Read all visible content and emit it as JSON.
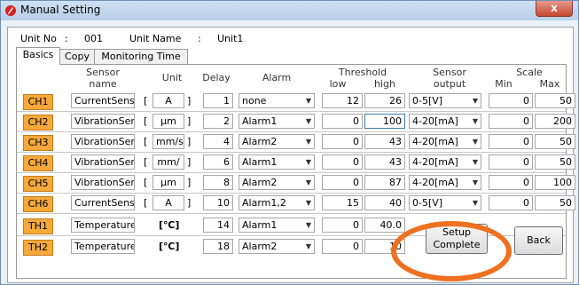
{
  "window": {
    "title": "Manual Setting",
    "close_label": "x"
  },
  "unit": {
    "no_label": "Unit No",
    "colon": ":",
    "no_value": "001",
    "name_label": "Unit Name",
    "name_value": "Unit1"
  },
  "tabs": [
    {
      "label": "Basics"
    },
    {
      "label": "Copy"
    },
    {
      "label": "Monitoring Time"
    }
  ],
  "headers": {
    "sensor_name_1": "Sensor",
    "sensor_name_2": "name",
    "unit": "Unit",
    "delay": "Delay",
    "alarm": "Alarm",
    "threshold": "Threshold",
    "low": "low",
    "high": "high",
    "sensor_output_1": "Sensor",
    "sensor_output_2": "output",
    "scale": "Scale",
    "min": "Min",
    "max": "Max"
  },
  "rows": [
    {
      "ch": "CH1",
      "name": "CurrentSens",
      "unit": "A",
      "delay": "1",
      "alarm": "none",
      "low": "12",
      "high": "26",
      "output": "0-5[V]",
      "min": "0",
      "max": "50"
    },
    {
      "ch": "CH2",
      "name": "VibrationSer",
      "unit": "μm",
      "delay": "2",
      "alarm": "Alarm1",
      "low": "0",
      "high": "100",
      "output": "4-20[mA]",
      "min": "0",
      "max": "200"
    },
    {
      "ch": "CH3",
      "name": "VibrationSer",
      "unit": "mm/s",
      "delay": "4",
      "alarm": "Alarm2",
      "low": "0",
      "high": "43",
      "output": "4-20[mA]",
      "min": "0",
      "max": "50"
    },
    {
      "ch": "CH4",
      "name": "VibrationSer",
      "unit": "mm/",
      "delay": "6",
      "alarm": "Alarm1",
      "low": "0",
      "high": "43",
      "output": "4-20[mA]",
      "min": "0",
      "max": "50"
    },
    {
      "ch": "CH5",
      "name": "VibrationSer",
      "unit": "μm",
      "delay": "8",
      "alarm": "Alarm2",
      "low": "0",
      "high": "87",
      "output": "4-20[mA]",
      "min": "0",
      "max": "100"
    },
    {
      "ch": "CH6",
      "name": "CurrentSens",
      "unit": "A",
      "delay": "10",
      "alarm": "Alarm1,2",
      "low": "15",
      "high": "40",
      "output": "0-5[V]",
      "min": "0",
      "max": "50"
    },
    {
      "ch": "TH1",
      "name": "Temperature",
      "unit": "[℃]",
      "delay": "14",
      "alarm": "Alarm1",
      "low": "0",
      "high": "40.0"
    },
    {
      "ch": "TH2",
      "name": "Temperature",
      "unit": "[℃]",
      "delay": "18",
      "alarm": "Alarm2",
      "low": "0",
      "high": "10"
    }
  ],
  "buttons": {
    "setup_line1": "Setup",
    "setup_line2": "Complete",
    "back": "Back"
  },
  "colors": {
    "channel_badge": "#f6a83b",
    "highlight_ring": "#ef7020",
    "title_bar": "#c3d7ee"
  }
}
